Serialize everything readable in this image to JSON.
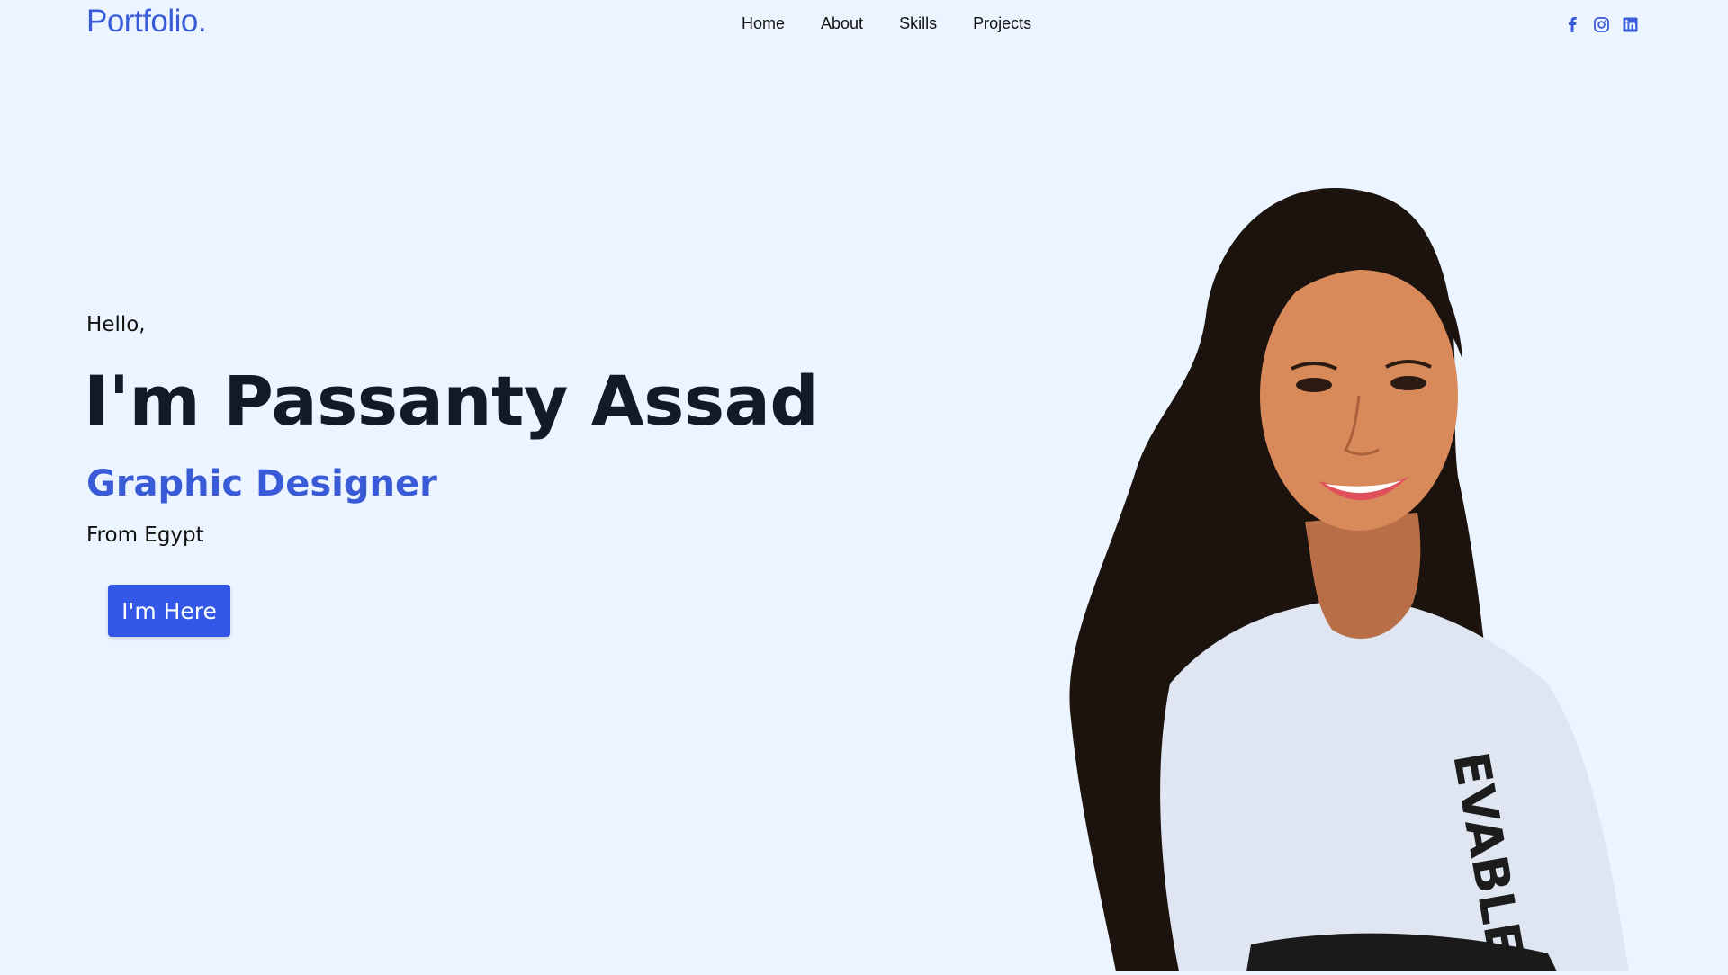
{
  "brand": {
    "logo": "Portfolio."
  },
  "nav": {
    "items": [
      {
        "label": "Home"
      },
      {
        "label": "About"
      },
      {
        "label": "Skills"
      },
      {
        "label": "Projects"
      }
    ]
  },
  "social": {
    "icons": [
      "facebook-icon",
      "instagram-icon",
      "linkedin-icon"
    ]
  },
  "hero": {
    "greeting": "Hello,",
    "name": "I'm Passanty Assad",
    "role": "Graphic Designer",
    "location": "From Egypt",
    "cta_label": "I'm Here"
  },
  "colors": {
    "background": "#ecf5ff",
    "accent": "#3a5bd7",
    "button": "#3358e8",
    "heading": "#111b27"
  }
}
